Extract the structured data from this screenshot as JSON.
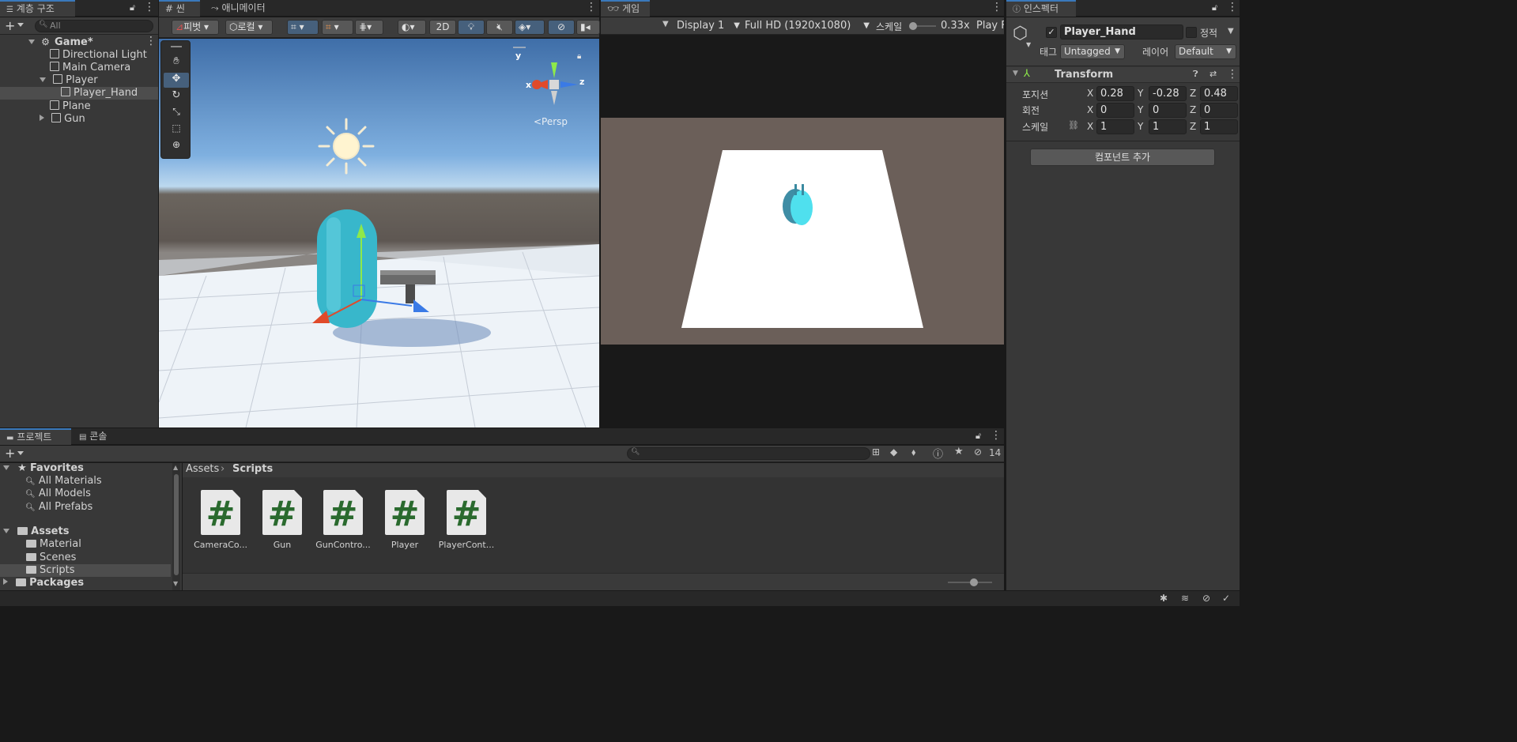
{
  "hierarchy": {
    "tab": "계층 구조",
    "search_placeholder": "All",
    "scene": "Game*",
    "items": [
      "Directional Light",
      "Main Camera",
      "Player",
      "Player_Hand",
      "Plane",
      "Gun"
    ]
  },
  "scene": {
    "tab": "씬",
    "tab2": "애니메이터",
    "pivot": "피벗",
    "local": "로컬",
    "mode2d": "2D",
    "persp": "<Persp",
    "gizmo_x": "x",
    "gizmo_y": "y",
    "gizmo_z": "z"
  },
  "game": {
    "tab": "게임",
    "display": "Display 1",
    "resolution": "Full HD (1920x1080)",
    "scale_label": "스케일",
    "scale_value": "0.33x",
    "play": "Play F",
    "scale_fraction": 0.1
  },
  "inspector": {
    "tab": "인스펙터",
    "name": "Player_Hand",
    "static": "정적",
    "tag_label": "태그",
    "tag": "Untagged",
    "layer_label": "레이어",
    "layer": "Default",
    "component": "Transform",
    "position_label": "포지션",
    "rotation_label": "회전",
    "scale_label": "스케일",
    "position": {
      "x": "0.28",
      "y": "-0.28",
      "z": "0.48"
    },
    "rotation": {
      "x": "0",
      "y": "0",
      "z": "0"
    },
    "scale": {
      "x": "1",
      "y": "1",
      "z": "1"
    },
    "axis_x": "X",
    "axis_y": "Y",
    "axis_z": "Z",
    "add_component": "컴포넌트 추가"
  },
  "project": {
    "tab": "프로젝트",
    "tab2": "콘솔",
    "hidden_count": "14",
    "favorites": "Favorites",
    "fav_items": [
      "All Materials",
      "All Models",
      "All Prefabs"
    ],
    "assets": "Assets",
    "asset_folders": [
      "Material",
      "Scenes",
      "Scripts"
    ],
    "packages": "Packages",
    "breadcrumb_root": "Assets",
    "breadcrumb_current": "Scripts",
    "files": [
      "CameraCo...",
      "Gun",
      "GunContro...",
      "Player",
      "PlayerCont..."
    ],
    "file_glyph": "#"
  },
  "colors": {
    "accent": "#3a79bb",
    "selected_row": "#4d4d4d",
    "script_green": "#2a6a2e"
  }
}
